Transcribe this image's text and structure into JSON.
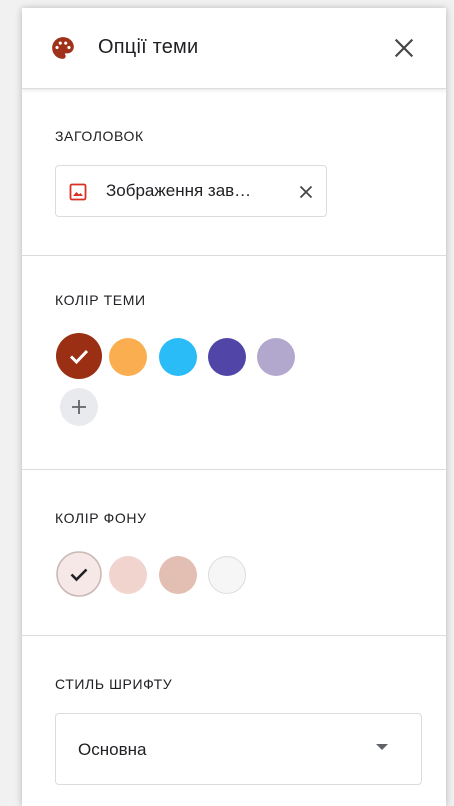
{
  "header": {
    "title": "Опції теми",
    "palette_icon": "palette-icon",
    "close_icon": "close-icon"
  },
  "header_section": {
    "label": "ЗАГОЛОВОК",
    "image_chip": {
      "text": "Зображення зав…",
      "image_icon": "image-icon",
      "remove_icon": "close-icon"
    }
  },
  "theme_color": {
    "label": "КОЛІР ТЕМИ",
    "swatches": [
      {
        "color": "#9a2f13",
        "selected": true
      },
      {
        "color": "#fbae4f",
        "selected": false
      },
      {
        "color": "#29bcf6",
        "selected": false
      },
      {
        "color": "#5145a8",
        "selected": false
      },
      {
        "color": "#b2a8cd",
        "selected": false
      }
    ],
    "add_icon": "plus-icon"
  },
  "background_color": {
    "label": "КОЛІР ФОНУ",
    "swatches": [
      {
        "color": "#f5e8e6",
        "selected": true
      },
      {
        "color": "#f0d4cd",
        "selected": false
      },
      {
        "color": "#e2beb3",
        "selected": false
      },
      {
        "color": "#f6f6f6",
        "selected": false
      }
    ]
  },
  "font_style": {
    "label": "СТИЛЬ ШРИФТУ",
    "selected": "Основна"
  },
  "colors": {
    "accent": "#a0311a",
    "text": "#202124",
    "divider": "#dadce0"
  }
}
